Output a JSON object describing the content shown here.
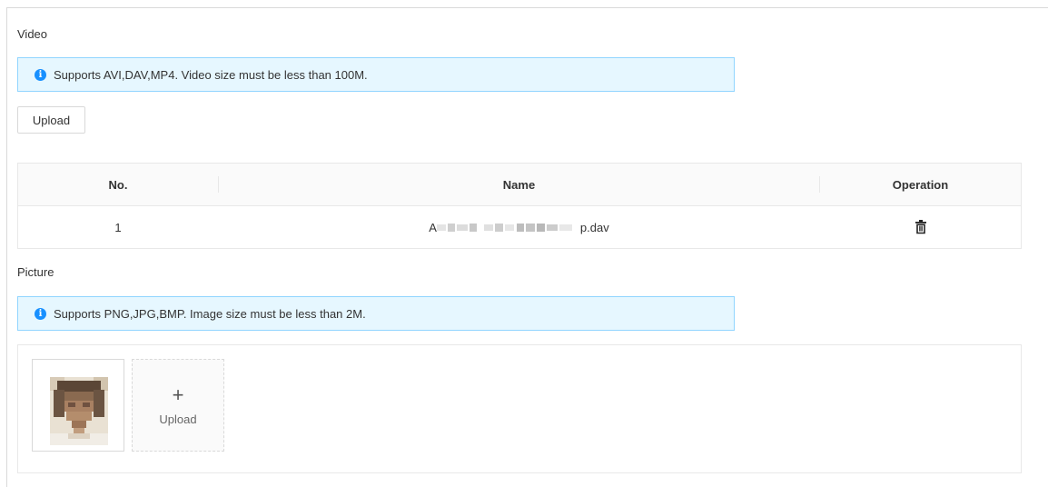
{
  "video": {
    "title": "Video",
    "info": "Supports AVI,DAV,MP4. Video size must be less than 100M.",
    "upload_label": "Upload",
    "table": {
      "headers": [
        "No.",
        "Name",
        "Operation"
      ],
      "rows": [
        {
          "no": "1",
          "name_prefix": "A",
          "name_suffix": "p.dav"
        }
      ]
    }
  },
  "picture": {
    "title": "Picture",
    "info": "Supports PNG,JPG,BMP. Image size must be less than 2M.",
    "upload_label": "Upload",
    "plus": "+"
  },
  "colors": {
    "info_bg": "#e6f7ff",
    "info_border": "#91d5ff",
    "info_icon": "#1890ff"
  },
  "icons": {
    "info": "info-circle-icon",
    "delete": "trash-icon",
    "add": "plus-icon"
  }
}
